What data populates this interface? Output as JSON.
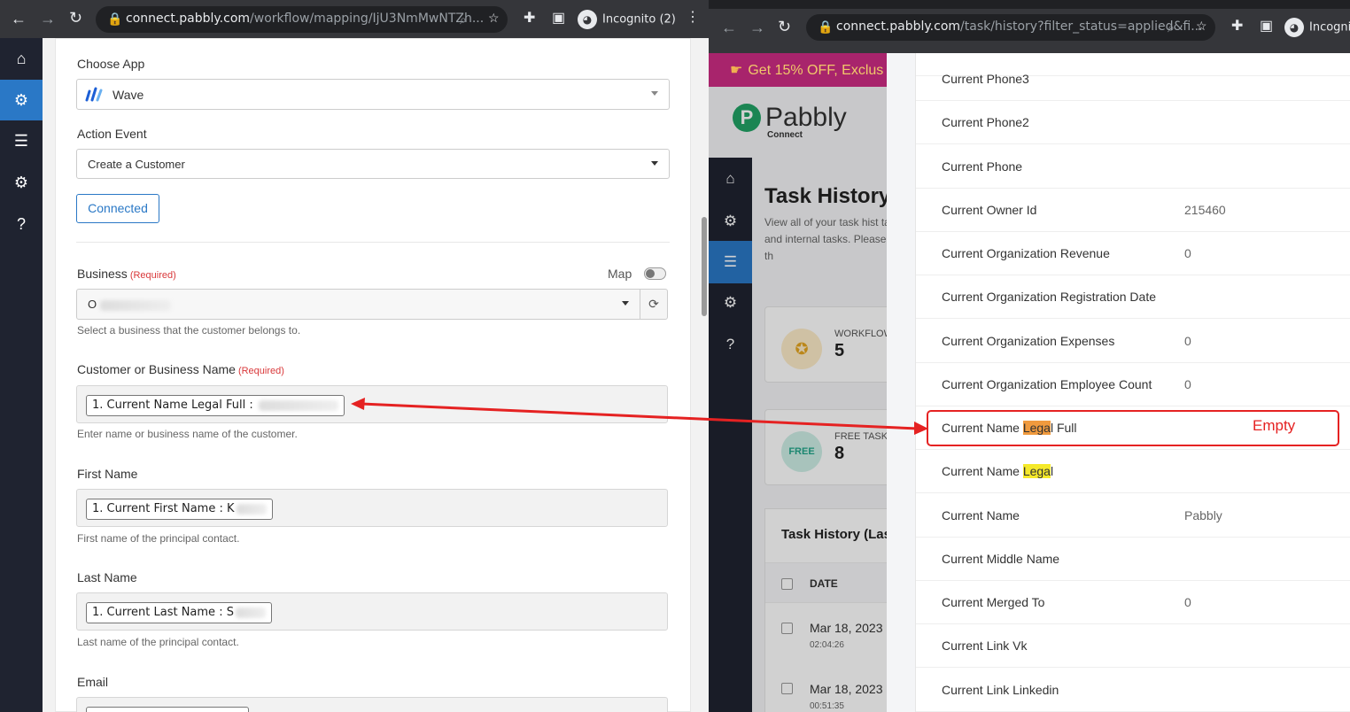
{
  "left_browser": {
    "url_host": "connect.pabbly.com",
    "url_path": "/workflow/mapping/IjU3NmMwNTZh...",
    "incognito_label": "Incognito (2)"
  },
  "right_browser": {
    "url_host": "connect.pabbly.com",
    "url_path": "/task/history?filter_status=applied&fi...",
    "incognito_label": "Incognit"
  },
  "left_form": {
    "choose_app_label": "Choose App",
    "app_value": "Wave",
    "action_event_label": "Action Event",
    "action_event_value": "Create a Customer",
    "connected_label": "Connected",
    "map_label": "Map",
    "required_text": "(Required)",
    "business": {
      "label": "Business",
      "value": "O",
      "help": "Select a business that the customer belongs to."
    },
    "customer_name": {
      "label": "Customer or Business Name",
      "chip": "1. Current Name Legal Full :",
      "help": "Enter name or business name of the customer."
    },
    "first_name": {
      "label": "First Name",
      "chip": "1. Current First Name : K",
      "help": "First name of the principal contact."
    },
    "last_name": {
      "label": "Last Name",
      "chip": "1. Current Last Name : S",
      "help": "Last name of the principal contact."
    },
    "email": {
      "label": "Email"
    }
  },
  "right_app": {
    "promo_text": "Get 15% OFF, Exclus",
    "logo_text": "Pabbly",
    "logo_sub": "Connect",
    "page_title": "Task History",
    "page_desc": "View all of your task hist task count, and internal tasks. Please note that th",
    "card1_label": "WORKFLOW",
    "card1_value": "5",
    "card2_label": "FREE TASK C",
    "card2_value": "8",
    "card2_icon": "FREE",
    "table_title": "Task History (Las",
    "table_col_date": "DATE",
    "rows": [
      {
        "date": "Mar 18, 2023",
        "time": "02:04:26"
      },
      {
        "date": "Mar 18, 2023",
        "time": "00:51:35"
      }
    ]
  },
  "details": [
    {
      "key": "Current Phone3",
      "value": ""
    },
    {
      "key": "Current Phone2",
      "value": ""
    },
    {
      "key": "Current Phone",
      "value": ""
    },
    {
      "key": "Current Owner Id",
      "value": "215460"
    },
    {
      "key": "Current Organization Revenue",
      "value": "0"
    },
    {
      "key": "Current Organization Registration Date",
      "value": ""
    },
    {
      "key": "Current Organization Expenses",
      "value": "0"
    },
    {
      "key": "Current Organization Employee Count",
      "value": "0"
    },
    {
      "key_pre": "Current Name ",
      "key_hl": "Lega",
      "key_post": "l Full",
      "hl": "orange",
      "value": ""
    },
    {
      "key_pre": "Current Name ",
      "key_hl": "Lega",
      "key_post": "l",
      "hl": "yellow",
      "value": ""
    },
    {
      "key": "Current Name",
      "value": "Pabbly"
    },
    {
      "key": "Current Middle Name",
      "value": ""
    },
    {
      "key": "Current Merged To",
      "value": "0"
    },
    {
      "key": "Current Link Vk",
      "value": ""
    },
    {
      "key": "Current Link Linkedin",
      "value": ""
    }
  ],
  "annotation": {
    "empty_label": "Empty",
    "color": "#e52222"
  }
}
